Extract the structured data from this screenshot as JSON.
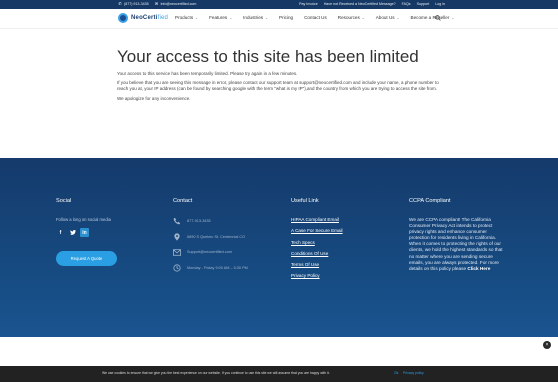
{
  "topbar": {
    "phone": "(877) 913-3435",
    "email": "info@neocertified.com",
    "links": [
      "Pay Invoice",
      "Have not Received a NeoCertified Message?",
      "FAQs",
      "Support",
      "Log in"
    ]
  },
  "header": {
    "logo_text": "NeoCerti",
    "logo_accent": "fied",
    "nav": [
      {
        "label": "Products",
        "dropdown": true
      },
      {
        "label": "Features",
        "dropdown": true
      },
      {
        "label": "Industries",
        "dropdown": true
      },
      {
        "label": "Pricing",
        "dropdown": false
      },
      {
        "label": "Contact Us",
        "dropdown": false
      },
      {
        "label": "Resources",
        "dropdown": true
      },
      {
        "label": "About Us",
        "dropdown": true
      },
      {
        "label": "Become a Reseller",
        "dropdown": true
      }
    ]
  },
  "main": {
    "title": "Your access to this site has been limited",
    "p1": "Your access to this service has been temporarily limited. Please try again in a few minutes.",
    "p2": "If you believe that you are seeing this message in error, please contact our support team at support@neocertified.com and include your name, a phone number to reach you at, your IP address (can be found by searching google with the term \"what is my IP\"),and the country from which you are trying to access the site from.",
    "p3": "We apologize for any inconvenience."
  },
  "footer": {
    "social": {
      "heading": "Social",
      "follow": "Follow a long on social media",
      "icons": [
        "facebook-icon",
        "twitter-icon",
        "linkedin-icon"
      ],
      "button": "Request A Quote"
    },
    "contact": {
      "heading": "Contact",
      "phone": "877-913-3435",
      "address": "6890 S Quebec St, Centennial CO",
      "email": "Support@neocertified.com",
      "hours": "Monday - Friday 9:00 AM – 5:30 PM"
    },
    "useful": {
      "heading": "Useful Link",
      "links": [
        "HIPAA Compliant Email",
        "A Case For Secure Email",
        "Tech Specs",
        "Conditions Of Use",
        "Terms Of Use",
        "Privacy Policy"
      ]
    },
    "ccpa": {
      "heading": "CCPA Compliant",
      "text": "We are CCPA compliant! The California Consumer Privacy Act intends to protect privacy rights and enhance consumer protection for residents living in California. When it comes to protecting the rights of our clients, we hold the highest standards so that no matter where you are sending secure emails, you are always protected. For more details on this policy please ",
      "link": "Click Here"
    }
  },
  "cookie": {
    "message": "We use cookies to ensure that we give you the best experience on our website. If you continue to use this site we will assume that you are happy with it.",
    "ok": "Ok",
    "privacy": "Privacy policy"
  },
  "colors": {
    "topbar": "#153864",
    "footer": "#164a80",
    "accent": "#2a9fe3",
    "cookie_bar": "#222222"
  }
}
